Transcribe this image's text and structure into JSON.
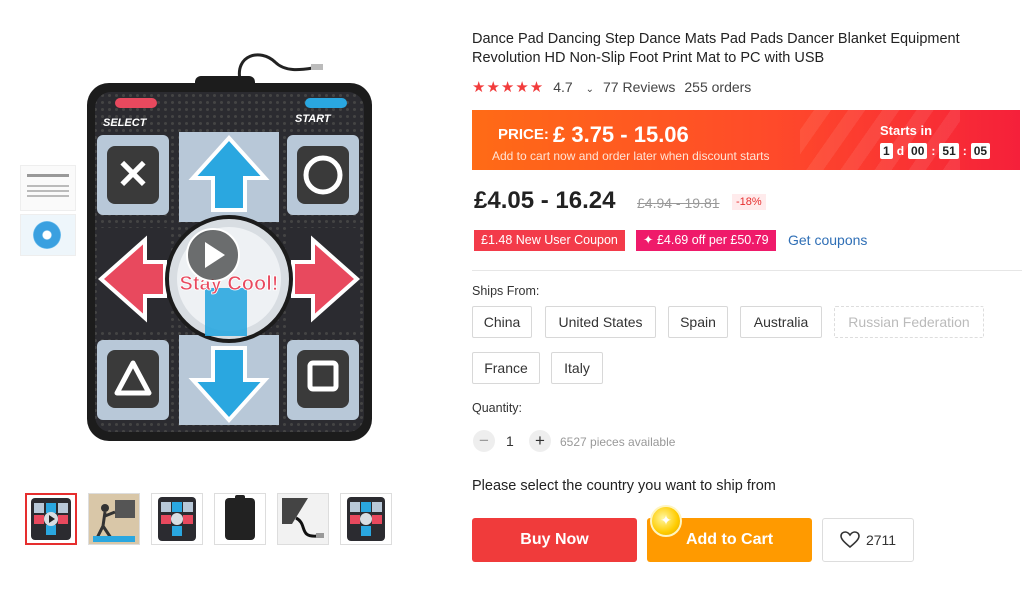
{
  "product": {
    "title": "Dance Pad Dancing Step Dance Mats Pad Pads Dancer Blanket Equipment Revolution HD Non-Slip Foot Print Mat to PC with USB",
    "rating": "4.7",
    "reviews": "77 Reviews",
    "orders": "255 orders",
    "stars": "★★★★★"
  },
  "image": {
    "left_label": "SELECT",
    "right_label": "START",
    "center_text": "Stay Cool!"
  },
  "promo": {
    "price_label": "PRICE:",
    "price_range": "£ 3.75 - 15.06",
    "subtitle": "Add to cart now and order later when discount starts",
    "starts_in": "Starts in",
    "countdown": {
      "days": "1",
      "days_unit": "d",
      "hours": "00",
      "minutes": "51",
      "seconds": "05"
    }
  },
  "pricing": {
    "current": "£4.05 - 16.24",
    "original": "£4.94 - 19.81",
    "discount": "-18%"
  },
  "coupons": {
    "new_user": "£1.48 New User Coupon",
    "off_per": "✦ £4.69 off per £50.79",
    "get_coupons": "Get coupons"
  },
  "ships_from": {
    "label": "Ships From:",
    "options": [
      "China",
      "United States",
      "Spain",
      "Australia",
      "Russian Federation",
      "France",
      "Italy"
    ]
  },
  "quantity": {
    "label": "Quantity:",
    "value": "1",
    "minus": "−",
    "plus": "+",
    "available": "6527 pieces available"
  },
  "notice": "Please select the country you want to ship from",
  "actions": {
    "buy_now": "Buy Now",
    "add_to_cart": "Add to Cart",
    "wishlist_count": "2711"
  },
  "colors": {
    "accent_red": "#f03b3b",
    "cart_orange": "#ff9a00",
    "link_blue": "#2f6fb6",
    "pad_pink": "#e8495e",
    "pad_blue": "#2aa7e0"
  }
}
